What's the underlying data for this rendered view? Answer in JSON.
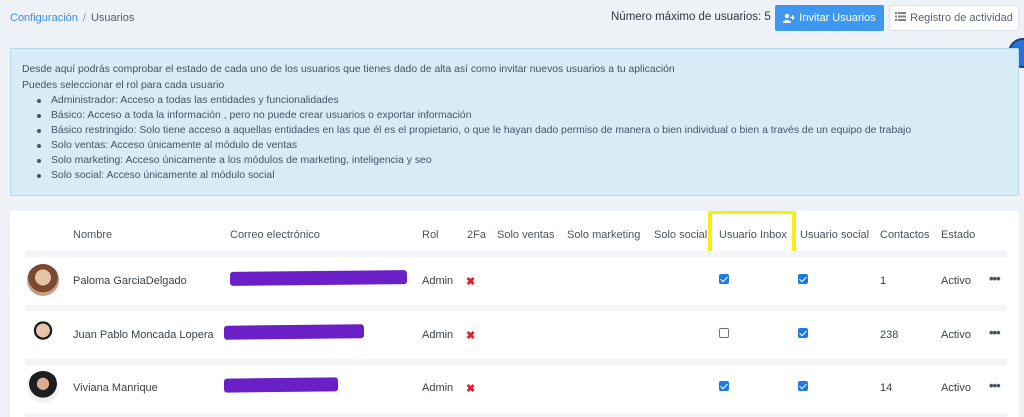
{
  "breadcrumb": {
    "parent": "Configuración",
    "separator": "/",
    "current": "Usuarios"
  },
  "header": {
    "max_users": "Número máximo de usuarios: 5",
    "invite_button": "Invitar Usuarios",
    "activity_button": "Registro de actividad"
  },
  "info": {
    "intro": "Desde aquí podrás comprobar el estado de cada uno de los usuarios que tienes dado de alta así como invitar nuevos usuarios a tu aplicación",
    "role_prompt": "Puedes seleccionar el rol para cada usuario",
    "roles": [
      "Administrador: Acceso a todas las entidades y funcionalidades",
      "Básico: Acceso a toda la información , pero no puede crear usuarios o exportar información",
      "Básico restringido: Solo tiene acceso a aquellas entidades en las que él es el propietario, o que le hayan dado permiso de manera o bien individual o bien a través de un equipo de trabajo",
      "Solo ventas: Acceso únicamente al módulo de ventas",
      "Solo marketing: Acceso únicamente a los módulos de marketing, inteligencia y seo",
      "Solo social: Acceso únicamente al módulo social"
    ]
  },
  "table": {
    "columns": [
      "Nombre",
      "Correo electrónico",
      "Rol",
      "2Fa",
      "Solo ventas",
      "Solo marketing",
      "Solo social",
      "Usuario Inbox",
      "Usuario social",
      "Contactos",
      "Estado"
    ],
    "rows": [
      {
        "name": "Paloma GarciaDelgado",
        "role": "Admin",
        "twofa": false,
        "inbox": true,
        "social": true,
        "contacts": "1",
        "status": "Activo"
      },
      {
        "name": "Juan Pablo Moncada Lopera",
        "role": "Admin",
        "twofa": false,
        "inbox": false,
        "social": true,
        "contacts": "238",
        "status": "Activo"
      },
      {
        "name": "Viviana Manrique",
        "role": "Admin",
        "twofa": false,
        "inbox": true,
        "social": true,
        "contacts": "14",
        "status": "Activo"
      }
    ],
    "row_menu": "•••"
  },
  "icons": {
    "twofa_off": "✖",
    "invite": "user-plus-icon",
    "activity": "list-icon"
  },
  "colors": {
    "accent": "#3f98ef",
    "redaction": "#6a1fc7",
    "highlight": "#f7ee12",
    "danger": "#e0202a"
  }
}
